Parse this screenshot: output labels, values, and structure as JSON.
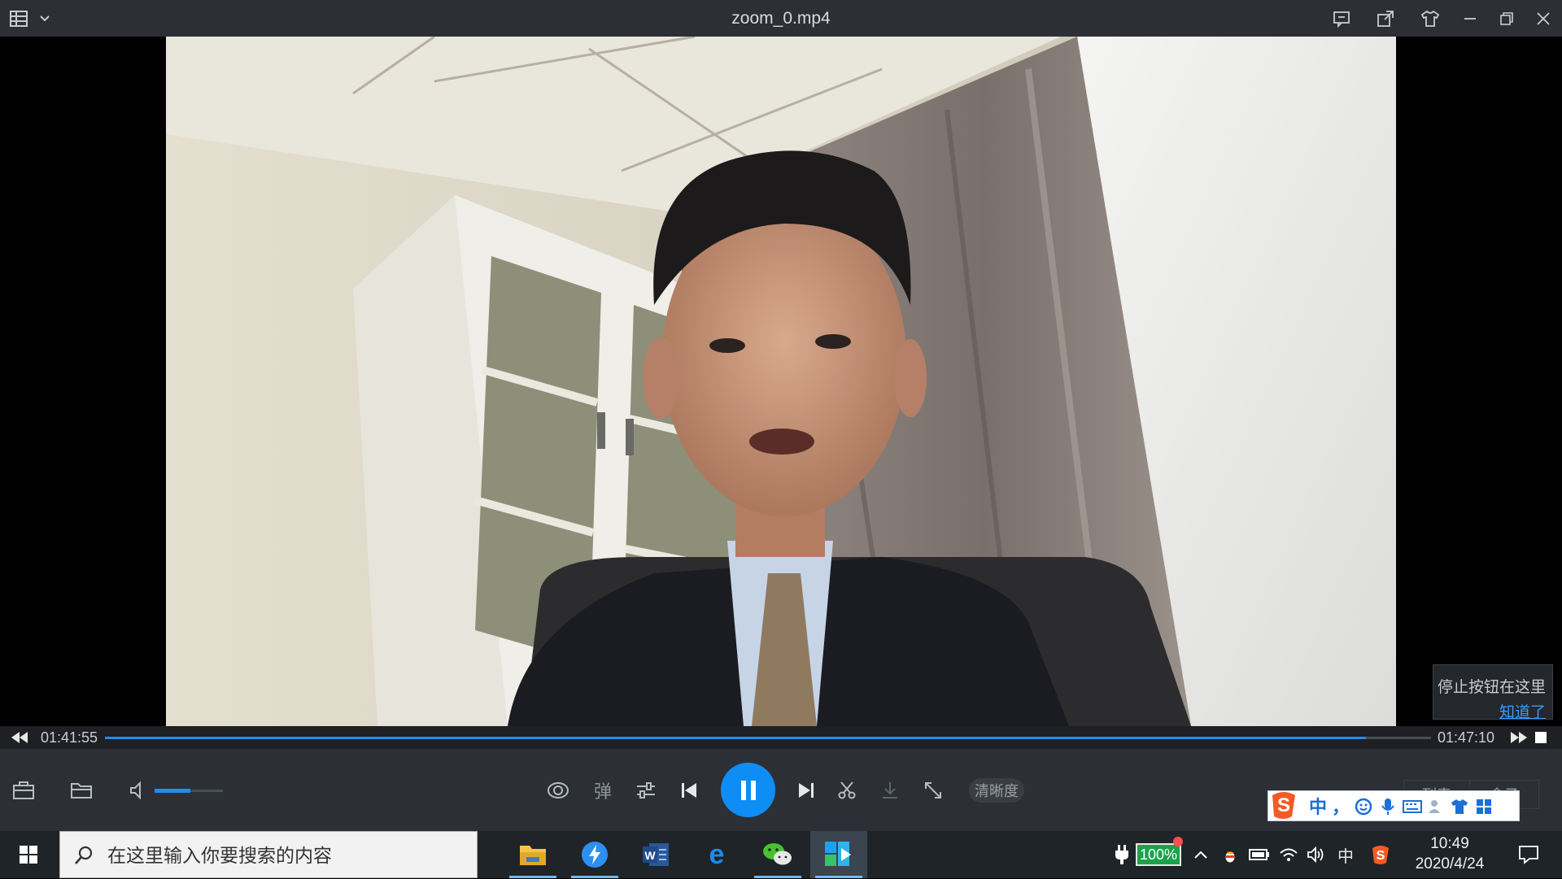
{
  "window": {
    "title": "zoom_0.mp4"
  },
  "player": {
    "elapsed": "01:41:55",
    "total": "01:47:10",
    "progress_fraction": 0.951,
    "volume_fraction": 0.52,
    "danmaku_label": "弹",
    "quality_label": "清晰度",
    "bottom_right_tabs": [
      "列表",
      "盒子"
    ]
  },
  "tooltip": {
    "text": "停止按钮在这里",
    "link": "知道了"
  },
  "ime": {
    "lang": "中",
    "punct": "，"
  },
  "taskbar": {
    "search_placeholder": "在这里输入你要搜索的内容",
    "battery": "100%",
    "tray_lang": "中",
    "time": "10:49",
    "date": "2020/4/24"
  },
  "colors": {
    "accent": "#1e8ef0",
    "titlebar": "#2c2f35",
    "taskbar": "#1f2428"
  }
}
